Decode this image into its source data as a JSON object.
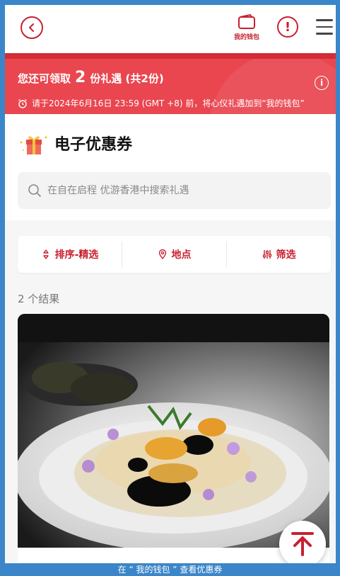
{
  "header": {
    "wallet_label": "我的钱包",
    "back_icon": "chevron-left-icon",
    "alert_icon": "exclamation-icon",
    "menu_icon": "hamburger-icon"
  },
  "banner": {
    "prefix": "您还可领取",
    "count": "2",
    "suffix": "份礼遇 (共2份)",
    "deadline": "请于2024年6月16日 23:59 (GMT +8) 前，将心仪礼遇加到“我的钱包”",
    "bg_color": "#e9464f"
  },
  "section": {
    "title": "电子优惠券"
  },
  "search": {
    "placeholder": "在自在启程 优游香港中搜索礼遇"
  },
  "filters": [
    {
      "label": "排序-精选",
      "icon": "sort-icon"
    },
    {
      "label": "地点",
      "icon": "location-pin-icon"
    },
    {
      "label": "筛选",
      "icon": "filter-sliders-icon"
    }
  ],
  "results": {
    "text": "2 个结果"
  },
  "caption": {
    "text": "在 “ 我的钱包 ” 查看优惠券"
  },
  "accent": "#c8202f"
}
